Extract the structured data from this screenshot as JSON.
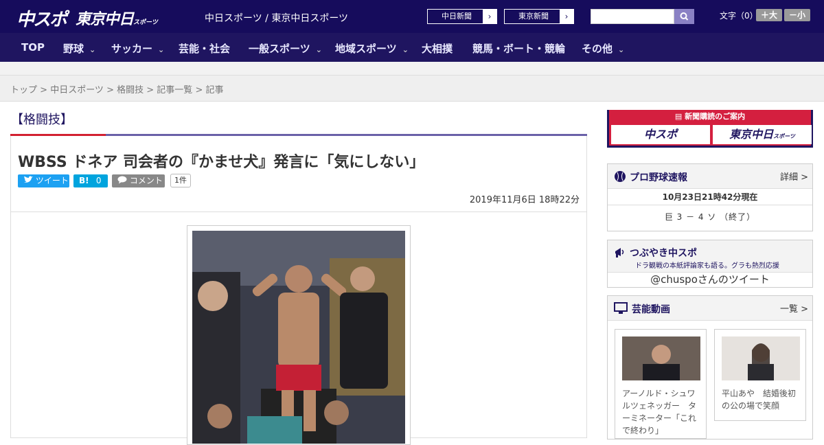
{
  "header": {
    "logo_chuspo": "中スポ",
    "logo_tokyo": "東京中日",
    "logo_tokyo_sub": "スポーツ",
    "tagline": "中日スポーツ / 東京中日スポーツ",
    "link_chunichi": "中日新聞",
    "link_tokyo": "東京新聞",
    "arrow": "›",
    "search_placeholder": "",
    "font_size_label": "文字（0）",
    "font_plus": "＋大",
    "font_minus": "－小"
  },
  "nav": {
    "items": [
      "TOP",
      "野球",
      "サッカー",
      "芸能・社会",
      "一般スポーツ",
      "地域スポーツ",
      "大相撲",
      "競馬・ボート・競輪",
      "その他"
    ],
    "caret": "⌄"
  },
  "breadcrumb": {
    "top": "トップ",
    "chunichi": "中日スポーツ",
    "kakutougi": "格闘技",
    "list": "記事一覧",
    "current": "記事",
    "sep": " > "
  },
  "article": {
    "category": "【格闘技】",
    "title": "WBSS ドネア 司会者の『かませ犬』発言に「気にしない」",
    "tweet": "ツイート",
    "hatena": "B!",
    "hatena_count": "0",
    "comment": "コメント",
    "comment_count": "1件",
    "date": "2019年11月6日 18時22分"
  },
  "sidebar": {
    "promo_caption": "新聞購読のご案内",
    "promo_chuspo": "中スポ",
    "promo_tokyo": "東京中日",
    "promo_tokyo_sub": "スポーツ",
    "baseball_title": "プロ野球速報",
    "baseball_more": "詳細 >",
    "baseball_time": "10月23日21時42分現在",
    "baseball_score": "巨 3 － 4 ソ （終了）",
    "tweet_title": "つぶやき中スポ",
    "tweet_sub": "ドラ観戦の本紙評論家も語る。グラも熱烈応援",
    "tweet_handle": "@chuspoさんのツイート",
    "video_title": "芸能動画",
    "video_more": "一覧 >",
    "video_items": [
      "アーノルド・シュワルツェネッガー　ターミネーター「これで終わり」",
      "平山あや　結婚後初の公の場で笑顔"
    ]
  },
  "colors": {
    "brand_navy": "#160c5c",
    "nav": "#1f1560",
    "accent_red": "#d22030",
    "twitter": "#1da1f2",
    "hatena": "#00a4de"
  }
}
